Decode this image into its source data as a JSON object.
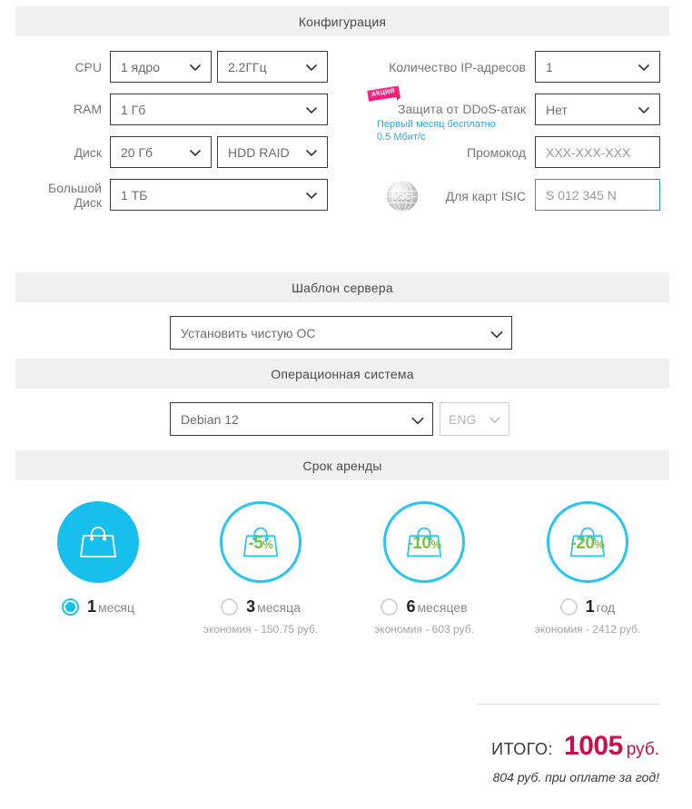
{
  "sections": {
    "configuration": "Конфигурация",
    "template": "Шаблон сервера",
    "os": "Операционная система",
    "period": "Срок аренды"
  },
  "config": {
    "cpu": {
      "label": "CPU",
      "cores": "1 ядро",
      "freq": "2.2ГГц"
    },
    "ram": {
      "label": "RAM",
      "value": "1 Гб"
    },
    "disk": {
      "label": "Диск",
      "size": "20 Гб",
      "type": "HDD RAID"
    },
    "bigdisk": {
      "label_line1": "Большой",
      "label_line2": "Диск",
      "value": "1 ТБ"
    },
    "ip": {
      "label": "Количество IP-адресов",
      "value": "1"
    },
    "ddos": {
      "badge": "АКЦИЯ",
      "label": "Защита от DDoS-атак",
      "note_line1": "Первый месяц бесплатно",
      "note_line2": "0.5 Мбит/с",
      "value": "Нет"
    },
    "promo": {
      "label": "Промокод",
      "placeholder": "XXX-XXX-XXX",
      "value": ""
    },
    "isic": {
      "icon_text": "isic",
      "label": "Для карт ISIC",
      "placeholder": "S 012 345 N",
      "value": ""
    }
  },
  "template_select": {
    "value": "Установить чистую ОС"
  },
  "os_select": {
    "value": "Debian 12",
    "lang": "ENG"
  },
  "periods": [
    {
      "id": "1m",
      "name_number": "1",
      "name_word": "месяц",
      "discount": "",
      "discount_pct": "",
      "saving": "",
      "selected": true
    },
    {
      "id": "3m",
      "name_number": "3",
      "name_word": "месяца",
      "discount": "-5",
      "discount_pct": "%",
      "saving": "экономия - 150.75 руб.",
      "selected": false
    },
    {
      "id": "6m",
      "name_number": "6",
      "name_word": "месяцев",
      "discount": "-10",
      "discount_pct": "%",
      "saving": "экономия - 603 руб.",
      "selected": false
    },
    {
      "id": "1y",
      "name_number": "1",
      "name_word": "год",
      "discount": "-20",
      "discount_pct": "%",
      "saving": "экономия - 2412 руб.",
      "selected": false
    }
  ],
  "total": {
    "label": "ИТОГО:",
    "value": "1005",
    "currency": "руб.",
    "note": "804 руб. при оплате за год!"
  },
  "colors": {
    "accent_cyan": "#16bfec",
    "accent_cyan_outline": "#29c4f0",
    "discount_green": "#79c342",
    "total_red": "#c8104a",
    "badge_pink": "#ee1c74",
    "isic_border": "#2a9ab0",
    "section_bar": "#f0f0f0"
  }
}
